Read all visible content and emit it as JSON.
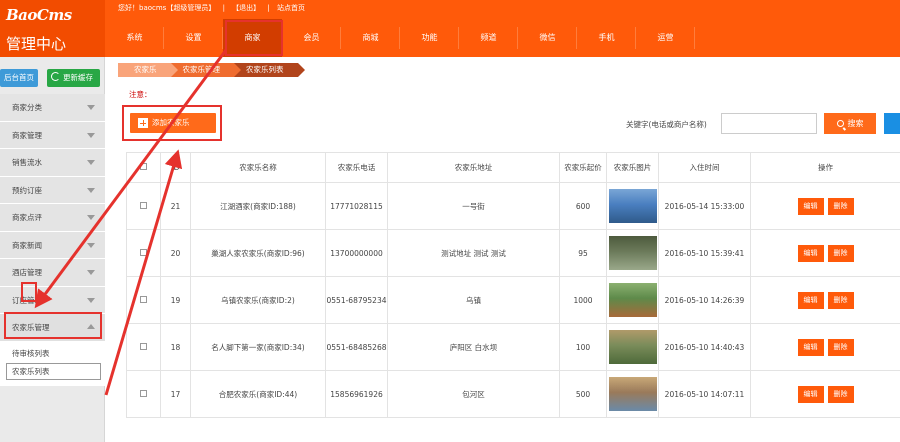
{
  "header": {
    "logo_en": "BaoCms",
    "logo_cn": "管理中心",
    "user_links": [
      "您好！baocms【超级管理员】",
      "|",
      "【退出】",
      "|",
      "站点首页"
    ],
    "nav": [
      "系统",
      "设置",
      "商家",
      "会员",
      "商城",
      "功能",
      "频道",
      "微信",
      "手机",
      "运营"
    ],
    "nav_active_index": 2
  },
  "sidebar": {
    "home_button": "后台首页",
    "refresh_button": "更新缓存",
    "menu": [
      "商家分类",
      "商家管理",
      "销售流水",
      "预约订座",
      "商家点评",
      "商家新闻",
      "酒店管理",
      "订座管理",
      "农家乐管理"
    ],
    "open_menu": "农家乐管理",
    "submenu": [
      "待审核列表",
      "农家乐列表"
    ],
    "active_sub": "农家乐列表"
  },
  "breadcrumb": [
    "农家乐",
    "农家乐管理",
    "农家乐列表"
  ],
  "notice": "注意：",
  "toolbar": {
    "add_label": "添加农家乐",
    "keyword_label": "关键字(电话或商户名称)",
    "keyword_value": "",
    "search_label": "搜索"
  },
  "table": {
    "headers": [
      "",
      "ID",
      "农家乐名称",
      "农家乐电话",
      "农家乐地址",
      "农家乐起价",
      "农家乐图片",
      "入住时间",
      "操作"
    ],
    "edit_label": "编辑",
    "delete_label": "删除",
    "rows": [
      {
        "id": "21",
        "name": "江湖酒家(商家ID:188)",
        "phone": "17771028115",
        "address": "一号街",
        "price": "600",
        "time": "2016-05-14 15:33:00"
      },
      {
        "id": "20",
        "name": "巢湖人家农家乐(商家ID:96)",
        "phone": "13700000000",
        "address": "测试地址 测试 测试",
        "price": "95",
        "time": "2016-05-10 15:39:41"
      },
      {
        "id": "19",
        "name": "乌镇农家乐(商家ID:2)",
        "phone": "0551-68795234",
        "address": "乌镇",
        "price": "1000",
        "time": "2016-05-10 14:26:39"
      },
      {
        "id": "18",
        "name": "名人脚下第一家(商家ID:34)",
        "phone": "0551-68485268",
        "address": "庐阳区 白水坝",
        "price": "100",
        "time": "2016-05-10 14:40:43"
      },
      {
        "id": "17",
        "name": "合肥农家乐(商家ID:44)",
        "phone": "15856961926",
        "address": "包河区",
        "price": "500",
        "time": "2016-05-10 14:07:11"
      }
    ]
  },
  "colors": {
    "brand_orange": "#ff5a0a",
    "nav_active": "#d23d00",
    "highlight_red": "#e5322d",
    "refresh_green": "#28a745",
    "home_blue": "#3e9ad8"
  }
}
